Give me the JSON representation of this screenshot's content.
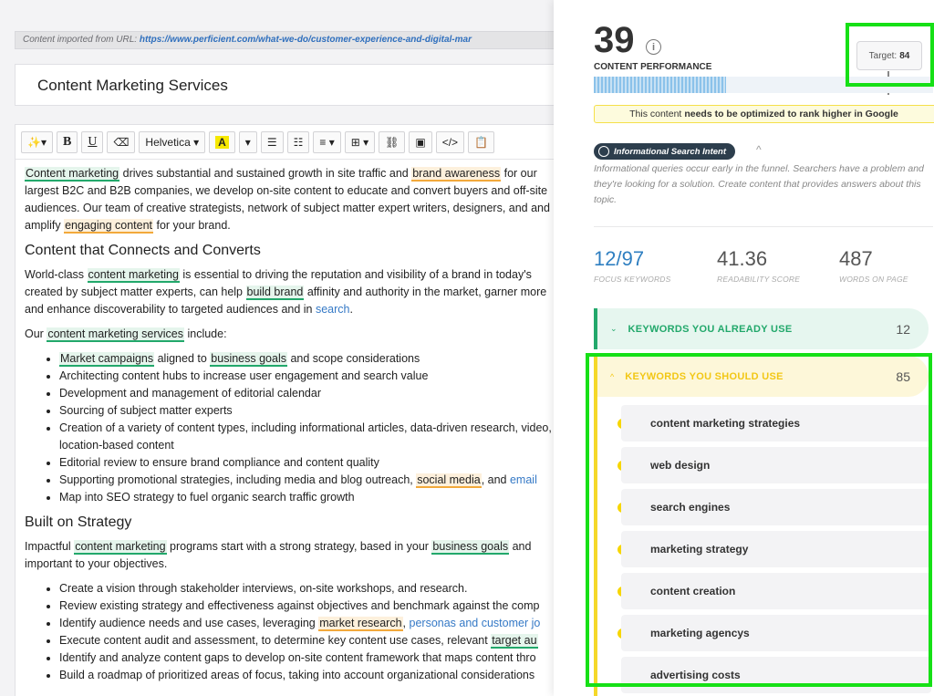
{
  "source": {
    "label": "Content imported from URL:",
    "url": "https://www.perficient.com/what-we-do/customer-experience-and-digital-mar"
  },
  "document": {
    "title": "Content Marketing Services"
  },
  "toolbar": {
    "magic_label": "✨▾",
    "bold": "B",
    "underline": "U",
    "clear_format": "⌫",
    "font": "Helvetica ▾",
    "highlight": "A",
    "dropdown": "▾",
    "bullet_list": "☰",
    "numbered_list": "☷",
    "align": "≡ ▾",
    "table": "⊞ ▾",
    "link": "⛓",
    "image": "▣",
    "code": "</>",
    "clipboard": "📋"
  },
  "body": {
    "p1": {
      "k1": "Content marketing",
      "t1": " drives substantial and sustained growth in site traffic and ",
      "k2": "brand awareness",
      "t2": " for our largest B2C and B2B companies, we develop on-site content to educate and convert buyers and off-site audiences. Our team of creative strategists, network of subject matter expert writers, designers, and and amplify ",
      "k3": "engaging content",
      "t3": " for your brand."
    },
    "h1": "Content that Connects and Converts",
    "p2": {
      "t1": "World-class ",
      "k1": "content marketing",
      "t2": " is essential to driving the reputation and visibility of a brand in today's created by subject matter experts, can help ",
      "k2": "build brand",
      "t3": " affinity and authority in the market, garner more and enhance discoverability to targeted audiences and in ",
      "link": "search",
      "t4": "."
    },
    "p3": {
      "t1": "Our ",
      "k1": "content marketing services",
      "t2": " include:"
    },
    "list1": {
      "i1": {
        "k1": "Market campaigns",
        "t1": " aligned to ",
        "k2": "business goals",
        "t2": " and scope considerations"
      },
      "i2": "Architecting content hubs to increase user engagement and search value",
      "i3": "Development and management of editorial calendar",
      "i4": "Sourcing of subject matter experts",
      "i5": "Creation of a variety of content types, including informational articles, data-driven research, video, location-based content",
      "i6": "Editorial review to ensure brand compliance and content quality",
      "i7": {
        "t1": "Supporting promotional strategies, including media and blog outreach, ",
        "k1": "social media",
        "t2": ", and ",
        "link": "email"
      },
      "i8": "Map into SEO strategy to fuel organic search traffic growth"
    },
    "h2": "Built on Strategy",
    "p4": {
      "t1": "Impactful ",
      "k1": "content marketing",
      "t2": " programs start with a strong strategy, based in your ",
      "k2": "business goals",
      "t3": " and important to your objectives."
    },
    "list2": {
      "i1": "Create a vision through stakeholder interviews, on-site workshops, and research.",
      "i2": "Review existing strategy and effectiveness against objectives and benchmark against the comp",
      "i3": {
        "t1": "Identify audience needs and use cases, leveraging ",
        "k1": "market research",
        "t2": ", ",
        "link": "personas and customer jo"
      },
      "i4": {
        "t1": "Execute content audit and assessment, to determine key content use cases, relevant ",
        "k1": "target au"
      },
      "i5": "Identify and analyze content gaps to develop on-site content framework that maps content thro",
      "i6": "Build a roadmap of prioritized areas of focus, taking into account organizational considerations"
    }
  },
  "panel": {
    "score": "39",
    "score_label": "CONTENT PERFORMANCE",
    "info_icon": "i",
    "target_label": "Target:",
    "target_value": "84",
    "progress_percent": 39,
    "alert_prefix": "This content",
    "alert_bold": "needs to be optimized to rank higher in Google",
    "intent_label": "Informational Search Intent",
    "intent_caret": "^",
    "intent_description": "Informational queries occur early in the funnel. Searchers have a problem and they're looking for a solution. Create content that provides answers about this topic.",
    "stats": {
      "focus_used": "12",
      "focus_total": "/97",
      "focus_label": "FOCUS KEYWORDS",
      "readability": "41.36",
      "readability_label": "READABILITY SCORE",
      "words": "487",
      "words_label": "WORDS ON PAGE"
    },
    "sections": {
      "use_title": "KEYWORDS YOU ALREADY USE",
      "use_count": "12",
      "use_chevron": "⌄",
      "should_title": "KEYWORDS YOU SHOULD USE",
      "should_count": "85",
      "should_chevron": "^"
    },
    "keywords": {
      "k0": "content marketing strategies",
      "k1": "web design",
      "k2": "search engines",
      "k3": "marketing strategy",
      "k4": "content creation",
      "k5": "marketing agencys",
      "k6": "advertising costs"
    },
    "colors": {
      "green": "#22a86b",
      "yellow": "#f5d829",
      "highlight_box": "#16e016",
      "blue": "#2f7fc1"
    }
  }
}
